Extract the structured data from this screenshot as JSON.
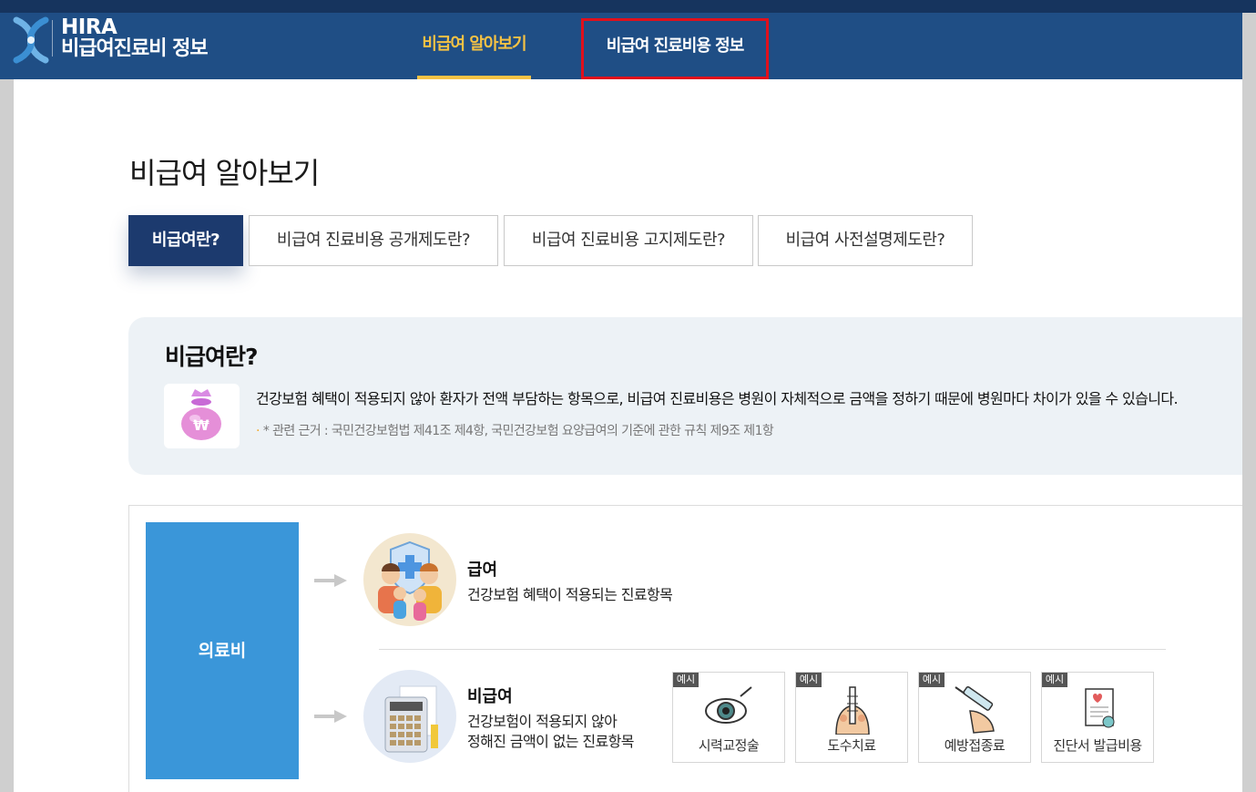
{
  "header": {
    "brand_line1": "HIRA",
    "brand_line2": "비급여진료비 정보",
    "nav": [
      {
        "label": "비급여 알아보기",
        "active": true
      },
      {
        "label": "비급여 진료비용 정보",
        "active": false,
        "highlighted": true
      }
    ]
  },
  "page": {
    "title": "비급여 알아보기",
    "subtabs": [
      {
        "label": "비급여란?",
        "active": true
      },
      {
        "label": "비급여 진료비용 공개제도란?"
      },
      {
        "label": "비급여 진료비용 고지제도란?"
      },
      {
        "label": "비급여 사전설명제도란?"
      }
    ]
  },
  "info": {
    "title": "비급여란?",
    "description": "건강보험 혜택이 적용되지 않아 환자가 전액 부담하는 항목으로, 비급여 진료비용은 병원이 자체적으로 금액을 정하기 때문에 병원마다 차이가 있을 수 있습니다.",
    "note": "* 관련 근거 : 국민건강보험법 제41조 제4항, 국민건강보험 요양급여의 기준에 관한 규칙 제9조 제1항",
    "icon": "money-bag-icon"
  },
  "diagram": {
    "root_label": "의료비",
    "covered": {
      "title": "급여",
      "description": "건강보험 혜택이 적용되는 진료항목"
    },
    "noncovered": {
      "title": "비급여",
      "description_line1": "건강보험이 적용되지 않아",
      "description_line2": "정해진 금액이 없는 진료항목"
    },
    "examples": [
      {
        "badge": "예시",
        "label": "시력교정술",
        "icon": "eye-icon"
      },
      {
        "badge": "예시",
        "label": "도수치료",
        "icon": "spine-icon"
      },
      {
        "badge": "예시",
        "label": "예방접종료",
        "icon": "syringe-icon"
      },
      {
        "badge": "예시",
        "label": "진단서 발급비용",
        "icon": "document-icon"
      }
    ]
  },
  "colors": {
    "header_bg": "#1f4e85",
    "active_nav": "#f5c244",
    "highlight_border": "#e0101c",
    "active_subtab": "#1c3a6e",
    "root_box": "#3a96d9",
    "info_bg": "#edf2f6"
  }
}
